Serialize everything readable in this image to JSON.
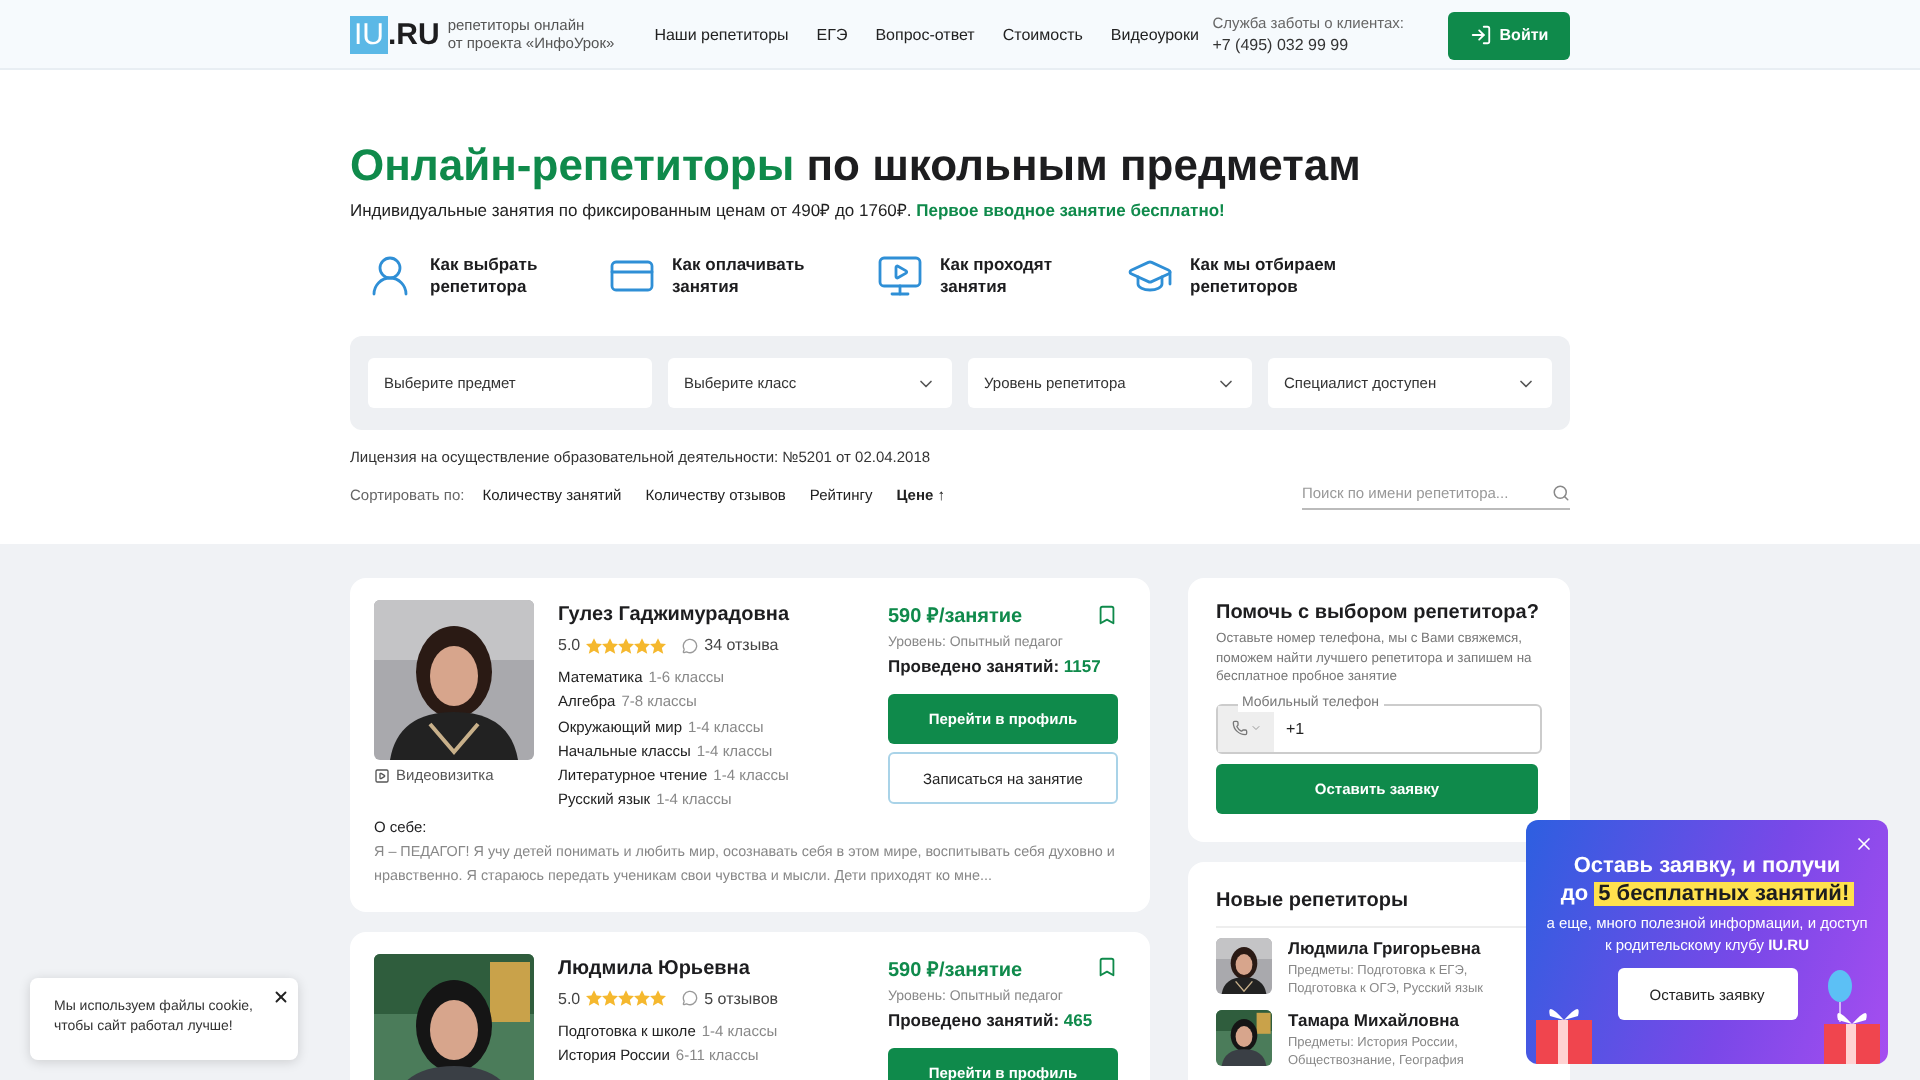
{
  "header": {
    "logo_box": "IU",
    "logo_rest": ".RU",
    "tagline": [
      "репетиторы онлайн",
      "от проекта «ИнфоУрок»"
    ],
    "nav": [
      "Наши репетиторы",
      "ЕГЭ",
      "Вопрос-ответ",
      "Стоимость",
      "Видеоуроки"
    ],
    "support_label": "Служба заботы о клиентах:",
    "support_phone": "+7 (495) 032 99 99",
    "login": "Войти"
  },
  "hero": {
    "title_highlight": "Онлайн-репетиторы",
    "title_rest": "по школьным предметам",
    "subtitle": "Индивидуальные занятия по фиксированным ценам от 490₽ до 1760₽.",
    "subtitle_highlight": "Первое вводное занятие бесплатно!",
    "features": [
      {
        "kind": "tutor",
        "label": "Как выбрать репетитора"
      },
      {
        "kind": "payment",
        "label": "Как оплачивать занятия"
      },
      {
        "kind": "lesson",
        "label": "Как проходят занятия"
      },
      {
        "kind": "selection",
        "label": "Как мы отбираем репетиторов"
      }
    ]
  },
  "filters": [
    {
      "placeholder": "Выберите предмет",
      "dropdown": false
    },
    {
      "placeholder": "Выберите класс",
      "dropdown": true
    },
    {
      "placeholder": "Уровень репетитора",
      "dropdown": true
    },
    {
      "placeholder": "Специалист доступен",
      "dropdown": true
    }
  ],
  "license": "Лицензия на осуществление образовательной деятельности: №5201 от 02.04.2018",
  "sort": {
    "label": "Сортировать по:",
    "options": [
      {
        "label": "Количеству занятий",
        "selected": false
      },
      {
        "label": "Количеству отзывов",
        "selected": false
      },
      {
        "label": "Рейтингу",
        "selected": false
      },
      {
        "label": "Цене ↑",
        "selected": true
      }
    ],
    "search_placeholder": "Поиск по имени репетитора..."
  },
  "tutors": [
    {
      "name": "Гулез Гаджимурадовна",
      "rating": "5.0",
      "stars": 5,
      "reviews": "34 отзыва",
      "video": "Видеовизитка",
      "price": "590 ₽/занятие",
      "level": "Уровень: Опытный педагог",
      "lessons_label": "Проведено занятий:",
      "lessons_count": "1157",
      "subjects": [
        {
          "name": "Математика",
          "grades": "1-6 классы"
        },
        {
          "name": "Алгебра",
          "grades": "7-8 классы"
        },
        {
          "name": "Окружающий мир",
          "grades": "1-4 классы"
        },
        {
          "name": "Начальные классы",
          "grades": "1-4 классы"
        },
        {
          "name": "Литературное чтение",
          "grades": "1-4 классы"
        },
        {
          "name": "Русский язык",
          "grades": "1-4 классы"
        }
      ],
      "about_label": "О себе:",
      "about": "Я – ПЕДАГОГ! Я учу детей понимать и любить мир, осознавать себя в этом мире, воспитывать себя духовно и нравственно. Я стараюсь передать ученикам свои чувства и мысли. Дети приходят ко мне...",
      "profile_button": "Перейти в профиль",
      "book_button": "Записаться на занятие"
    },
    {
      "name": "Людмила Юрьевна",
      "rating": "5.0",
      "stars": 5,
      "reviews": "5 отзывов",
      "price": "590 ₽/занятие",
      "level": "Уровень: Опытный педагог",
      "lessons_label": "Проведено занятий:",
      "lessons_count": "465",
      "subjects": [
        {
          "name": "Подготовка к школе",
          "grades": "1-4 классы"
        },
        {
          "name": "История России",
          "grades": "6-11 классы"
        }
      ],
      "profile_button": "Перейти в профиль"
    }
  ],
  "help": {
    "title": "Помочь с выбором репетитора?",
    "text": "Оставьте номер телефона, мы с Вами свяжемся, поможем найти лучшего репетитора и запишем на бесплатное пробное занятие",
    "phone_label": "Мобильный телефон",
    "phone_value": "+1",
    "button": "Оставить заявку"
  },
  "new_tutors": {
    "title": "Новые репетиторы",
    "items": [
      {
        "name": "Людмила Григорьевна",
        "subjects": "Предметы: Подготовка к ЕГЭ, Подготовка к ОГЭ, Русский язык"
      },
      {
        "name": "Тамара Михайловна",
        "subjects": "Предметы: История России, Обществознание, География"
      }
    ]
  },
  "promo": {
    "title": "Оставь заявку, и получи",
    "prefix": "до",
    "highlight": "5 бесплатных занятий!",
    "text": "а еще, много полезной информации, и доступ к родительскому клубу **IU.RU**",
    "button": "Оставить заявку"
  },
  "cookie": {
    "text": "Мы используем файлы cookie, чтобы сайт работал лучше!"
  }
}
